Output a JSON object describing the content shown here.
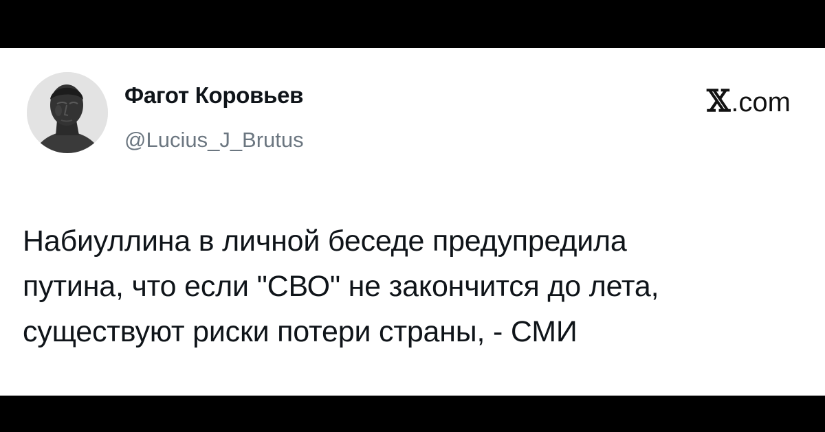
{
  "author": {
    "display_name": "Фагот Коровьев",
    "handle": "@Lucius_J_Brutus",
    "avatar": "classical-bust-avatar"
  },
  "brand": {
    "logo_icon": "x-logo-icon",
    "domain": ".com"
  },
  "tweet": {
    "lines": [
      "Набиуллина в личной беседе предупредила",
      "путина, что если \"СВО\" не закончится до лета,",
      "существуют риски потери страны, - СМИ"
    ]
  }
}
